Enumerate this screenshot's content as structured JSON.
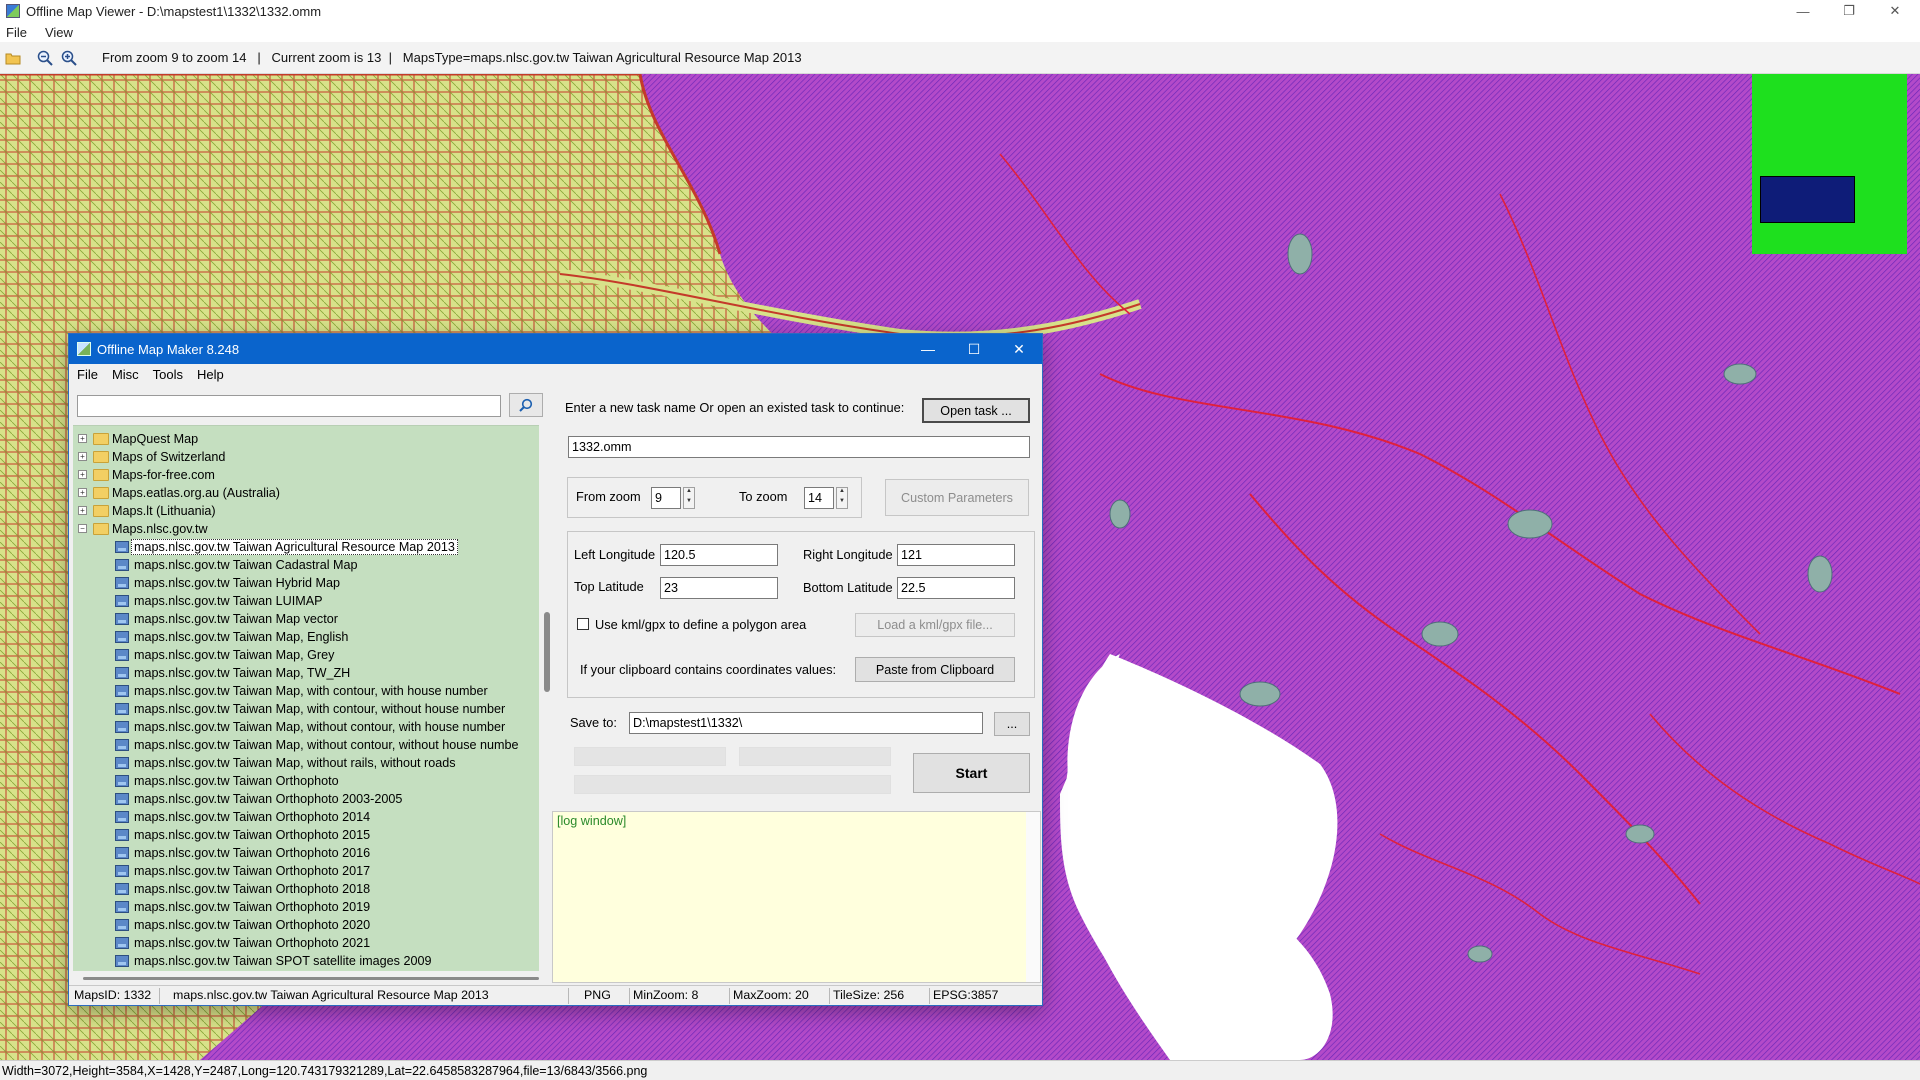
{
  "viewer": {
    "title": "Offline Map Viewer - D:\\mapstest1\\1332\\1332.omm",
    "menu": [
      "File",
      "View"
    ],
    "toolbar_info": "From zoom 9 to zoom 14   |   Current zoom is 13  |   MapsType=maps.nlsc.gov.tw Taiwan Agricultural Resource Map 2013",
    "status": "Width=3072,Height=3584,X=1428,Y=2487,Long=120.743179321289,Lat=22.6458583287964,file=13/6843/3566.png",
    "minimap_color": "#1ee01e",
    "minimap_view_color": "#0e1c78"
  },
  "dialog": {
    "title": "Offline Map Maker 8.248",
    "menu": [
      "File",
      "Misc",
      "Tools",
      "Help"
    ],
    "search_value": "",
    "tree": [
      {
        "label": "MapQuest Map",
        "type": "folder",
        "expanded": false
      },
      {
        "label": "Maps of Switzerland",
        "type": "folder",
        "expanded": false
      },
      {
        "label": "Maps-for-free.com",
        "type": "folder",
        "expanded": false
      },
      {
        "label": "Maps.eatlas.org.au (Australia)",
        "type": "folder",
        "expanded": false
      },
      {
        "label": "Maps.lt (Lithuania)",
        "type": "folder",
        "expanded": false
      },
      {
        "label": "Maps.nlsc.gov.tw",
        "type": "folder",
        "expanded": true
      },
      {
        "label": "maps.nlsc.gov.tw Taiwan Agricultural Resource Map 2013",
        "type": "map",
        "selected": true
      },
      {
        "label": "maps.nlsc.gov.tw Taiwan Cadastral Map",
        "type": "map"
      },
      {
        "label": "maps.nlsc.gov.tw Taiwan Hybrid Map",
        "type": "map"
      },
      {
        "label": "maps.nlsc.gov.tw Taiwan LUIMAP",
        "type": "map"
      },
      {
        "label": "maps.nlsc.gov.tw Taiwan Map vector",
        "type": "map"
      },
      {
        "label": "maps.nlsc.gov.tw Taiwan Map, English",
        "type": "map"
      },
      {
        "label": "maps.nlsc.gov.tw Taiwan Map, Grey",
        "type": "map"
      },
      {
        "label": "maps.nlsc.gov.tw Taiwan Map, TW_ZH",
        "type": "map"
      },
      {
        "label": "maps.nlsc.gov.tw Taiwan Map, with contour, with house number",
        "type": "map"
      },
      {
        "label": "maps.nlsc.gov.tw Taiwan Map, with contour, without house number",
        "type": "map"
      },
      {
        "label": "maps.nlsc.gov.tw Taiwan Map, without contour, with house number",
        "type": "map"
      },
      {
        "label": "maps.nlsc.gov.tw Taiwan Map, without contour, without house numbe",
        "type": "map"
      },
      {
        "label": "maps.nlsc.gov.tw Taiwan Map, without rails, without roads",
        "type": "map"
      },
      {
        "label": "maps.nlsc.gov.tw Taiwan Orthophoto",
        "type": "map"
      },
      {
        "label": "maps.nlsc.gov.tw Taiwan Orthophoto 2003-2005",
        "type": "map"
      },
      {
        "label": "maps.nlsc.gov.tw Taiwan Orthophoto 2014",
        "type": "map"
      },
      {
        "label": "maps.nlsc.gov.tw Taiwan Orthophoto 2015",
        "type": "map"
      },
      {
        "label": "maps.nlsc.gov.tw Taiwan Orthophoto 2016",
        "type": "map"
      },
      {
        "label": "maps.nlsc.gov.tw Taiwan Orthophoto 2017",
        "type": "map"
      },
      {
        "label": "maps.nlsc.gov.tw Taiwan Orthophoto 2018",
        "type": "map"
      },
      {
        "label": "maps.nlsc.gov.tw Taiwan Orthophoto 2019",
        "type": "map"
      },
      {
        "label": "maps.nlsc.gov.tw Taiwan Orthophoto 2020",
        "type": "map"
      },
      {
        "label": "maps.nlsc.gov.tw Taiwan Orthophoto 2021",
        "type": "map"
      },
      {
        "label": "maps.nlsc.gov.tw Taiwan SPOT satellite images 2009",
        "type": "map"
      }
    ],
    "task": {
      "prompt": "Enter a new task name Or open an existed task to continue:",
      "open_label": "Open task ...",
      "name_value": "1332.omm"
    },
    "zoom": {
      "from_label": "From zoom",
      "from_value": "9",
      "to_label": "To zoom",
      "to_value": "14",
      "custom_label": "Custom Parameters"
    },
    "coords": {
      "left_label": "Left Longitude",
      "left_value": "120.5",
      "right_label": "Right Longitude",
      "right_value": "121",
      "top_label": "Top Latitude",
      "top_value": "23",
      "bottom_label": "Bottom Latitude",
      "bottom_value": "22.5",
      "kml_label": "Use kml/gpx to define a polygon area",
      "kml_checked": false,
      "kml_button": "Load a kml/gpx file...",
      "clip_label": "If your clipboard contains coordinates values:",
      "clip_button": "Paste from Clipboard"
    },
    "save": {
      "label": "Save to:",
      "value": "D:\\mapstest1\\1332\\",
      "browse": "..."
    },
    "start_label": "Start",
    "log_text": "[log window]",
    "status": {
      "maps_id": "MapsID: 1332",
      "map_name": "maps.nlsc.gov.tw Taiwan Agricultural Resource Map 2013",
      "format": "PNG",
      "min_zoom": "MinZoom: 8",
      "max_zoom": "MaxZoom: 20",
      "tile_size": "TileSize: 256",
      "epsg": "EPSG:3857"
    }
  }
}
